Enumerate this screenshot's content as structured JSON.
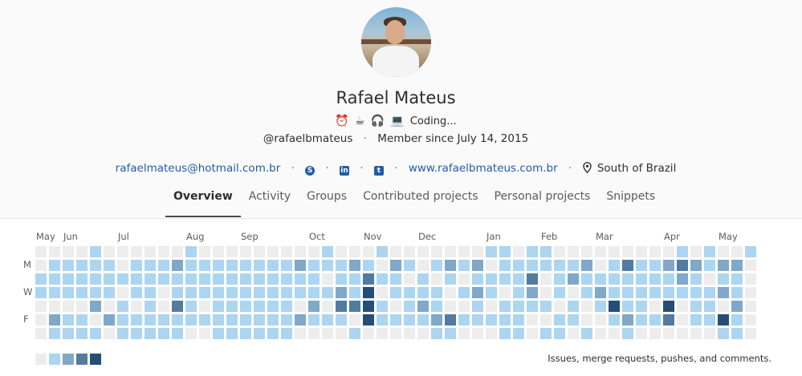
{
  "profile": {
    "name": "Rafael Mateus",
    "status_emojis": [
      "⏰",
      "☕",
      "🎧",
      "💻"
    ],
    "status_text": "Coding...",
    "username": "@rafaelbmateus",
    "member_since": "Member since July 14, 2015",
    "email": "rafaelmateus@hotmail.com.br",
    "website": "www.rafaelbmateus.com.br",
    "location": "South of Brazil",
    "social_icons": [
      "skype-icon",
      "linkedin-icon",
      "twitter-icon"
    ]
  },
  "tabs": [
    {
      "label": "Overview",
      "active": true
    },
    {
      "label": "Activity",
      "active": false
    },
    {
      "label": "Groups",
      "active": false
    },
    {
      "label": "Contributed projects",
      "active": false
    },
    {
      "label": "Personal projects",
      "active": false
    },
    {
      "label": "Snippets",
      "active": false
    }
  ],
  "calendar": {
    "months": [
      {
        "label": "May",
        "week": 0
      },
      {
        "label": "Jun",
        "week": 2
      },
      {
        "label": "Jul",
        "week": 6
      },
      {
        "label": "Aug",
        "week": 11
      },
      {
        "label": "Sep",
        "week": 15
      },
      {
        "label": "Oct",
        "week": 20
      },
      {
        "label": "Nov",
        "week": 24
      },
      {
        "label": "Dec",
        "week": 28
      },
      {
        "label": "Jan",
        "week": 33
      },
      {
        "label": "Feb",
        "week": 37
      },
      {
        "label": "Mar",
        "week": 41
      },
      {
        "label": "Apr",
        "week": 46
      },
      {
        "label": "May",
        "week": 50
      }
    ],
    "day_labels": [
      {
        "label": "M",
        "row": 1
      },
      {
        "label": "W",
        "row": 3
      },
      {
        "label": "F",
        "row": 5
      }
    ],
    "colors": [
      "#ededed",
      "#acd5f2",
      "#7fa8c9",
      "#527ba0",
      "#254e77"
    ],
    "weeks": [
      [
        0,
        0,
        1,
        1,
        0,
        0,
        0
      ],
      [
        0,
        1,
        1,
        1,
        0,
        2,
        1
      ],
      [
        0,
        1,
        1,
        1,
        0,
        1,
        1
      ],
      [
        0,
        1,
        1,
        1,
        0,
        1,
        1
      ],
      [
        1,
        1,
        1,
        1,
        2,
        0,
        1
      ],
      [
        0,
        1,
        1,
        1,
        0,
        2,
        0
      ],
      [
        0,
        0,
        1,
        0,
        1,
        1,
        1
      ],
      [
        0,
        1,
        1,
        1,
        0,
        1,
        1
      ],
      [
        0,
        1,
        1,
        1,
        1,
        1,
        1
      ],
      [
        0,
        1,
        1,
        0,
        0,
        1,
        1
      ],
      [
        0,
        2,
        1,
        1,
        3,
        1,
        1
      ],
      [
        1,
        1,
        1,
        1,
        1,
        1,
        0
      ],
      [
        0,
        1,
        1,
        1,
        0,
        1,
        0
      ],
      [
        0,
        1,
        1,
        1,
        1,
        1,
        1
      ],
      [
        0,
        1,
        1,
        1,
        1,
        1,
        1
      ],
      [
        0,
        1,
        1,
        1,
        1,
        1,
        1
      ],
      [
        0,
        1,
        1,
        1,
        1,
        1,
        1
      ],
      [
        0,
        1,
        1,
        1,
        1,
        1,
        1
      ],
      [
        0,
        1,
        1,
        1,
        1,
        1,
        1
      ],
      [
        0,
        2,
        1,
        1,
        0,
        2,
        0
      ],
      [
        0,
        1,
        1,
        1,
        2,
        1,
        0
      ],
      [
        1,
        1,
        0,
        1,
        0,
        1,
        0
      ],
      [
        0,
        1,
        1,
        2,
        3,
        1,
        0
      ],
      [
        0,
        2,
        1,
        1,
        3,
        0,
        1
      ],
      [
        0,
        1,
        3,
        4,
        4,
        4,
        0
      ],
      [
        1,
        0,
        1,
        0,
        1,
        1,
        0
      ],
      [
        0,
        2,
        1,
        1,
        0,
        1,
        0
      ],
      [
        0,
        1,
        0,
        1,
        1,
        1,
        0
      ],
      [
        0,
        0,
        1,
        1,
        2,
        1,
        0
      ],
      [
        0,
        1,
        0,
        1,
        1,
        2,
        1
      ],
      [
        0,
        2,
        1,
        0,
        0,
        3,
        1
      ],
      [
        0,
        1,
        0,
        1,
        0,
        1,
        0
      ],
      [
        0,
        2,
        1,
        2,
        1,
        1,
        0
      ],
      [
        1,
        0,
        1,
        1,
        0,
        1,
        0
      ],
      [
        1,
        1,
        1,
        0,
        1,
        1,
        1
      ],
      [
        0,
        1,
        1,
        1,
        1,
        1,
        1
      ],
      [
        1,
        1,
        3,
        2,
        1,
        0,
        0
      ],
      [
        1,
        1,
        0,
        0,
        1,
        0,
        1
      ],
      [
        0,
        1,
        1,
        1,
        0,
        1,
        1
      ],
      [
        0,
        1,
        2,
        0,
        1,
        1,
        0
      ],
      [
        0,
        2,
        1,
        1,
        0,
        0,
        1
      ],
      [
        0,
        0,
        1,
        2,
        1,
        0,
        0
      ],
      [
        0,
        1,
        1,
        1,
        4,
        1,
        0
      ],
      [
        0,
        3,
        1,
        1,
        1,
        2,
        1
      ],
      [
        0,
        1,
        1,
        1,
        1,
        1,
        0
      ],
      [
        0,
        1,
        1,
        1,
        0,
        1,
        0
      ],
      [
        0,
        2,
        1,
        1,
        4,
        3,
        0
      ],
      [
        1,
        3,
        2,
        1,
        0,
        0,
        0
      ],
      [
        0,
        2,
        1,
        1,
        1,
        1,
        0
      ],
      [
        1,
        1,
        0,
        1,
        1,
        1,
        0
      ],
      [
        0,
        2,
        1,
        2,
        0,
        4,
        1
      ],
      [
        0,
        2,
        1,
        1,
        2,
        1,
        1
      ],
      [
        1,
        0,
        0,
        0,
        0,
        0,
        0
      ]
    ],
    "legend_text": "Issues, merge requests, pushes, and comments."
  }
}
